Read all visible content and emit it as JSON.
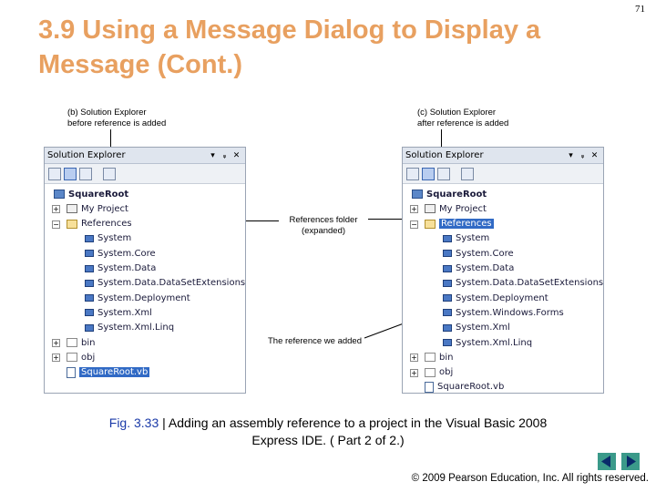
{
  "slide": {
    "title": "3.9  Using a Message Dialog to Display a Message (Cont.)",
    "number": "71"
  },
  "captions": {
    "b_line1": "(b) Solution Explorer",
    "b_line2": "before reference is added",
    "c_line1": "(c) Solution Explorer",
    "c_line2": "after reference is added",
    "refs_line1": "References folder",
    "refs_line2": "(expanded)",
    "added": "The reference we added"
  },
  "panel_left": {
    "title": "Solution Explorer",
    "controls": [
      "▾",
      "ᵩ",
      "✕"
    ],
    "items": [
      {
        "label": "SquareRoot",
        "icon": "project-icon",
        "bold": true
      },
      {
        "label": "My Project",
        "icon": "my-project-icon"
      },
      {
        "label": "References",
        "icon": "folder-open-icon"
      },
      {
        "label": "System",
        "icon": "reference-icon"
      },
      {
        "label": "System.Core",
        "icon": "reference-icon"
      },
      {
        "label": "System.Data",
        "icon": "reference-icon"
      },
      {
        "label": "System.Data.DataSetExtensions",
        "icon": "reference-icon"
      },
      {
        "label": "System.Deployment",
        "icon": "reference-icon"
      },
      {
        "label": "System.Xml",
        "icon": "reference-icon"
      },
      {
        "label": "System.Xml.Linq",
        "icon": "reference-icon"
      },
      {
        "label": "bin",
        "icon": "folder-icon"
      },
      {
        "label": "obj",
        "icon": "folder-icon"
      },
      {
        "label": "SquareRoot.vb",
        "icon": "vb-file-icon",
        "selected": true
      }
    ]
  },
  "panel_right": {
    "title": "Solution Explorer",
    "controls": [
      "▾",
      "ᵩ",
      "✕"
    ],
    "items": [
      {
        "label": "SquareRoot",
        "icon": "project-icon",
        "bold": true
      },
      {
        "label": "My Project",
        "icon": "my-project-icon"
      },
      {
        "label": "References",
        "icon": "folder-open-icon",
        "selected": true
      },
      {
        "label": "System",
        "icon": "reference-icon"
      },
      {
        "label": "System.Core",
        "icon": "reference-icon"
      },
      {
        "label": "System.Data",
        "icon": "reference-icon"
      },
      {
        "label": "System.Data.DataSetExtensions",
        "icon": "reference-icon"
      },
      {
        "label": "System.Deployment",
        "icon": "reference-icon"
      },
      {
        "label": "System.Windows.Forms",
        "icon": "reference-icon"
      },
      {
        "label": "System.Xml",
        "icon": "reference-icon"
      },
      {
        "label": "System.Xml.Linq",
        "icon": "reference-icon"
      },
      {
        "label": "bin",
        "icon": "folder-icon"
      },
      {
        "label": "obj",
        "icon": "folder-icon"
      },
      {
        "label": "SquareRoot.vb",
        "icon": "vb-file-icon"
      }
    ]
  },
  "figure": {
    "label": "Fig. 3.33",
    "separator": " | ",
    "text": "Adding an assembly reference to a project in the Visual Basic 2008 Express IDE. ( Part 2 of 2.)"
  },
  "nav": {
    "prev_icon": "prev-slide-icon",
    "next_icon": "next-slide-icon"
  },
  "copyright": "© 2009 Pearson Education, Inc.  All rights reserved.",
  "colors": {
    "title": "#e8a060",
    "figure_label": "#1a3aa8",
    "selection": "#316ac5",
    "nav": "#3b9a8a"
  }
}
